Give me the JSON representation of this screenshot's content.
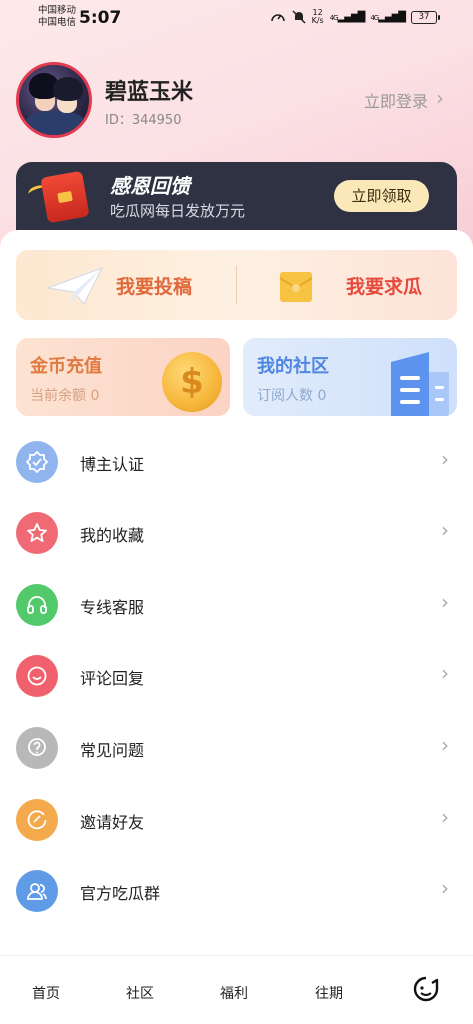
{
  "status_bar": {
    "carrier_1": "中国移动",
    "carrier_2": "中国电信",
    "time": "5:07",
    "speed_value": "12",
    "speed_unit": "K/s",
    "net_1": "4G",
    "net_2": "4G",
    "battery": "37"
  },
  "profile": {
    "username": "碧蓝玉米",
    "user_id": "ID：344950",
    "login_label": "立即登录"
  },
  "banner": {
    "title": "感恩回馈",
    "subtitle": "吃瓜网每日发放万元",
    "claim_label": "立即领取"
  },
  "actions": {
    "submit_label": "我要投稿",
    "request_label": "我要求瓜"
  },
  "tiles": {
    "coins_title": "金币充值",
    "coins_sub": "当前余额 0",
    "community_title": "我的社区",
    "community_sub": "订阅人数 0"
  },
  "menu": [
    {
      "label": "博主认证",
      "icon": "verified-badge-icon",
      "color": "#8fb4ee"
    },
    {
      "label": "我的收藏",
      "icon": "star-icon",
      "color": "#f06a75"
    },
    {
      "label": "专线客服",
      "icon": "headset-icon",
      "color": "#52c96a"
    },
    {
      "label": "评论回复",
      "icon": "smile-comment-icon",
      "color": "#f0616d"
    },
    {
      "label": "常见问题",
      "icon": "question-icon",
      "color": "#b8b8b8"
    },
    {
      "label": "邀请好友",
      "icon": "invite-icon",
      "color": "#f4a94c"
    },
    {
      "label": "官方吃瓜群",
      "icon": "group-icon",
      "color": "#5f9be6"
    }
  ],
  "bottom_nav": {
    "home": "首页",
    "community": "社区",
    "welfare": "福利",
    "past": "往期"
  },
  "colors": {
    "accent_orange": "#e0683a",
    "accent_red": "#e64a3c",
    "accent_blue": "#4f86e0",
    "banner_bg": "#2e3242"
  }
}
